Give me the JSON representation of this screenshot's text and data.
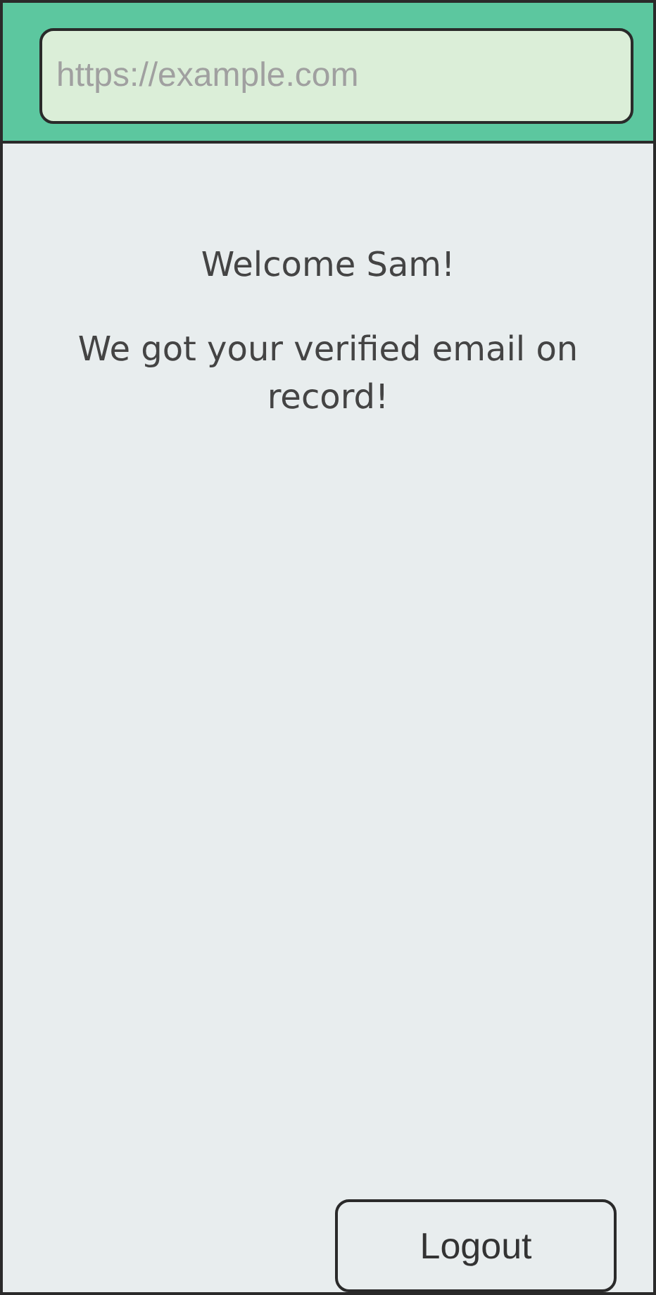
{
  "address_bar": {
    "placeholder": "https://example.com"
  },
  "greeting": "Welcome Sam!",
  "message": "We got your verified email on record!",
  "buttons": [
    "Logout"
  ]
}
